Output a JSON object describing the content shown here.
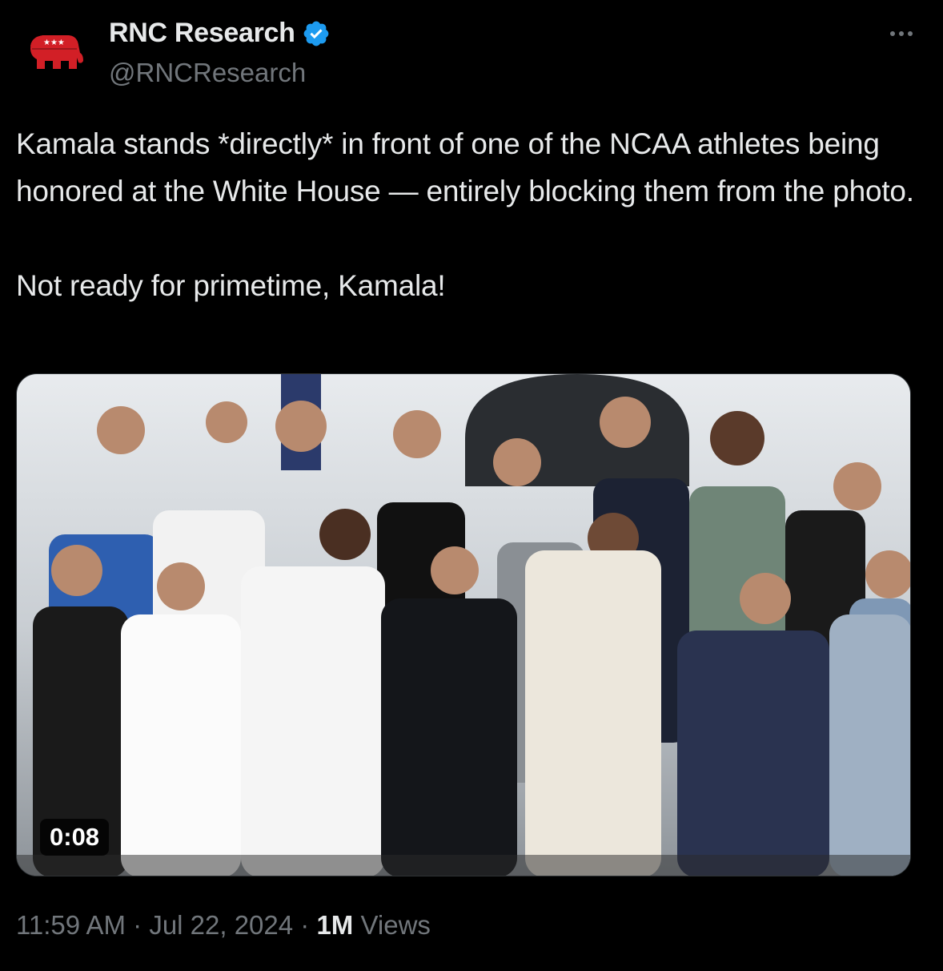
{
  "author": {
    "display_name": "RNC Research",
    "handle": "@RNCResearch",
    "verified": true,
    "avatar_icon": "gop-elephant-logo"
  },
  "tweet": {
    "text": "Kamala stands *directly* in front of one of the NCAA athletes being honored at the White House — entirely blocking them from the photo.\n\nNot ready for primetime, Kamala!"
  },
  "media": {
    "type": "video",
    "duration": "0:08"
  },
  "footer": {
    "time": "11:59 AM",
    "separator1": " · ",
    "date": "Jul 22, 2024",
    "separator2": " · ",
    "views_count": "1M",
    "views_label": " Views"
  },
  "colors": {
    "background": "#000000",
    "text_primary": "#e7e9ea",
    "text_secondary": "#71767b",
    "verified_blue": "#1d9bf0",
    "logo_red": "#d21f26"
  }
}
